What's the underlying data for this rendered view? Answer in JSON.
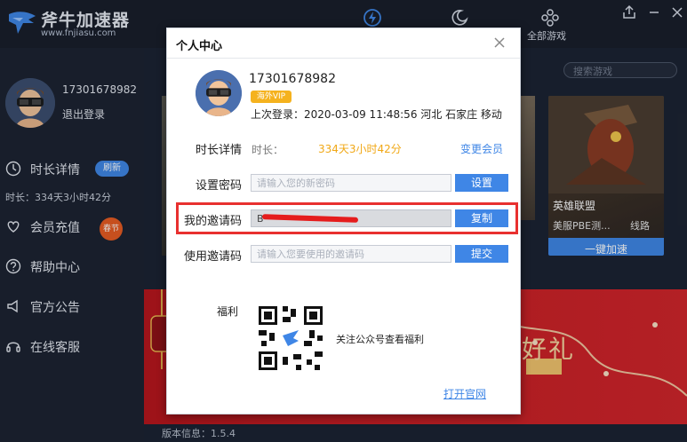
{
  "app": {
    "title": "斧牛加速器",
    "url": "www.fnjiasu.com",
    "nav_all_games": "全部游戏",
    "version": "版本信息：1.5.4"
  },
  "sidebar": {
    "phone": "17301678982",
    "logout": "退出登录",
    "items": [
      {
        "label": "时长详情",
        "icon": "clock-icon"
      },
      {
        "label": "会员充值",
        "icon": "heart-plus-icon"
      },
      {
        "label": "帮助中心",
        "icon": "question-icon"
      },
      {
        "label": "官方公告",
        "icon": "megaphone-icon"
      },
      {
        "label": "在线客服",
        "icon": "headset-icon"
      }
    ],
    "refresh_badge": "刷新",
    "time_text": "时长：334天3小时42分",
    "spring_badge": "春节"
  },
  "main": {
    "search_placeholder": "搜索游戏",
    "game": {
      "title": "英雄联盟",
      "sub": "美服PBE测...",
      "route": "线路",
      "accelerate": "一键加速"
    },
    "banner_text": "好礼"
  },
  "dialog": {
    "title": "个人中心",
    "phone": "17301678982",
    "vip": "海外VIP",
    "last_login": "上次登录：2020-03-09 11:48:56 河北 石家庄 移动",
    "duration_label": "时长详情",
    "duration_prefix": "时长：",
    "duration_value": "334天3小时42分",
    "change_member": "变更会员",
    "password_label": "设置密码",
    "password_placeholder": "请输入您的新密码",
    "password_button": "设置",
    "invite_label": "我的邀请码",
    "invite_value": "B",
    "copy_button": "复制",
    "use_invite_label": "使用邀请码",
    "use_invite_placeholder": "请输入您要使用的邀请码",
    "submit_button": "提交",
    "welfare_label": "福利",
    "qr_caption": "关注公众号查看福利",
    "official_link": "打开官网"
  },
  "colors": {
    "accent": "#3f86e6",
    "highlight": "#e8302f",
    "vip": "#f5b21e",
    "duration": "#f1a816",
    "banner": "#c81c22"
  }
}
